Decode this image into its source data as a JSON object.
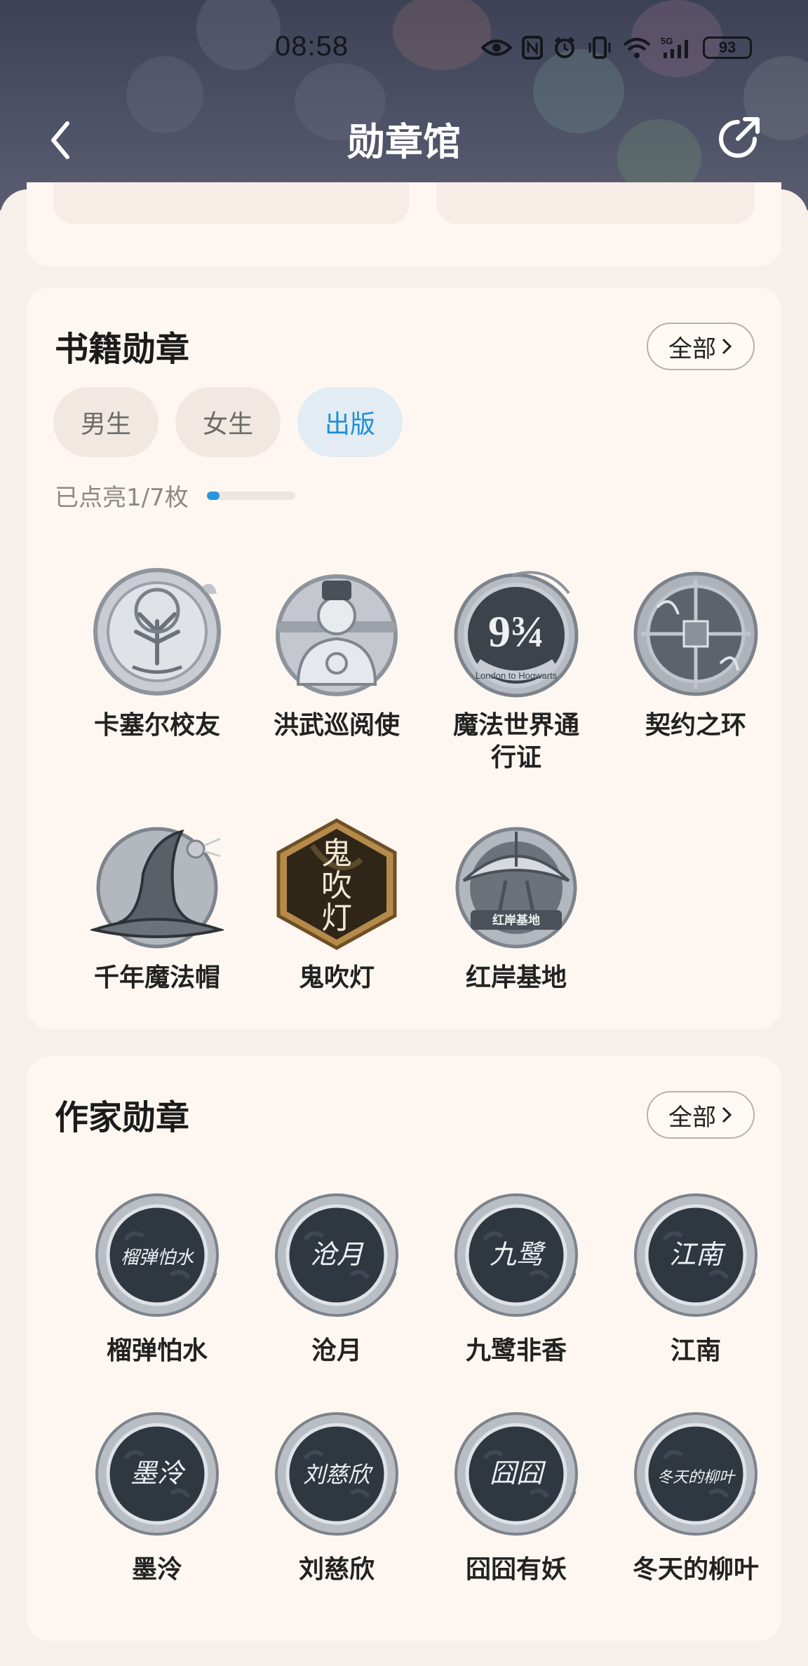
{
  "status_bar": {
    "time": "08:58",
    "battery": "93",
    "network": "5G"
  },
  "nav": {
    "title": "勋章馆",
    "back_icon": "chevron-left-icon",
    "share_icon": "share-icon"
  },
  "book_section": {
    "title": "书籍勋章",
    "all_label": "全部",
    "tabs": [
      {
        "label": "男生",
        "active": false
      },
      {
        "label": "女生",
        "active": false
      },
      {
        "label": "出版",
        "active": true
      }
    ],
    "progress_text": "已点亮1/7枚",
    "progress": {
      "lit": 1,
      "total": 7
    },
    "badges": [
      {
        "label": "卡塞尔校友",
        "icon": "tree-badge-icon",
        "lit": false
      },
      {
        "label": "洪武巡阅使",
        "icon": "official-badge-icon",
        "lit": false
      },
      {
        "label": "魔法世界通行证",
        "icon": "platform-badge-icon",
        "lit": false,
        "emblem_text": "London to Hogwarts"
      },
      {
        "label": "契约之环",
        "icon": "ring-badge-icon",
        "lit": false
      },
      {
        "label": "千年魔法帽",
        "icon": "hat-badge-icon",
        "lit": false
      },
      {
        "label": "鬼吹灯",
        "icon": "lamp-badge-icon",
        "lit": true,
        "emblem_text": "鬼吹灯"
      },
      {
        "label": "红岸基地",
        "icon": "dish-badge-icon",
        "lit": false,
        "emblem_text": "红岸基地"
      }
    ]
  },
  "author_section": {
    "title": "作家勋章",
    "all_label": "全部",
    "badges": [
      {
        "label": "榴弹怕水",
        "signature": "榴弹怕水"
      },
      {
        "label": "沧月",
        "signature": "沧月"
      },
      {
        "label": "九鹭非香",
        "signature": "九鹭"
      },
      {
        "label": "江南",
        "signature": "江南"
      },
      {
        "label": "墨泠",
        "signature": "墨泠"
      },
      {
        "label": "刘慈欣",
        "signature": "刘慈欣"
      },
      {
        "label": "囧囧有妖",
        "signature": "囧囧"
      },
      {
        "label": "冬天的柳叶",
        "signature": "冬天的柳叶"
      }
    ]
  },
  "colors": {
    "accent": "#1e8fd6",
    "header": "#4a4e62",
    "card": "#fef7f1",
    "page": "#f6efea"
  }
}
